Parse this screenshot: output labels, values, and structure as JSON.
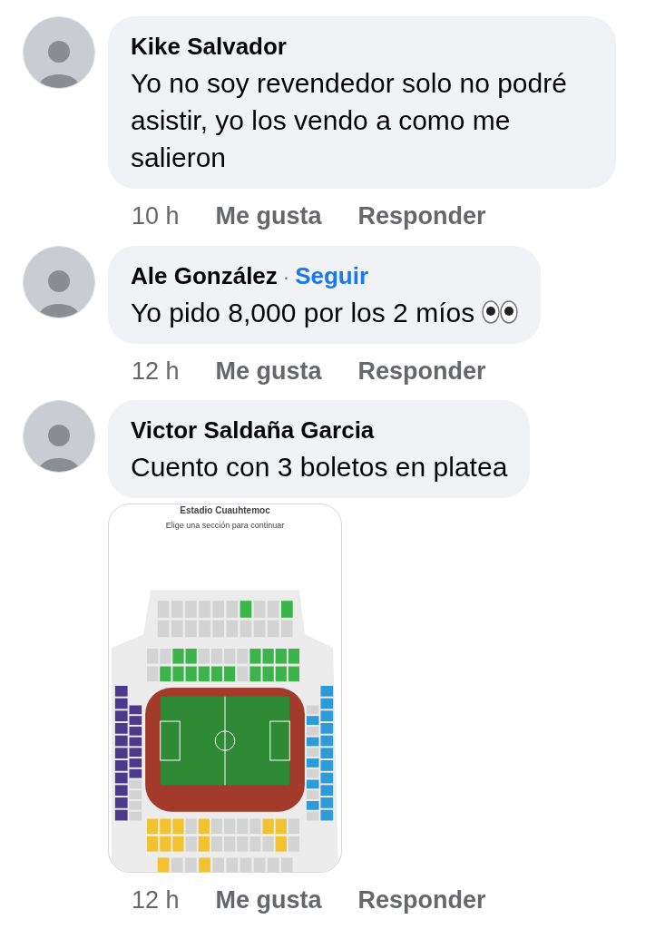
{
  "comments": [
    {
      "author": "Kike Salvador",
      "text": "Yo no soy revendedor solo no podré asistir, yo los vendo a como me salieron",
      "time": "10 h",
      "actions": [
        "Me gusta",
        "Responder"
      ]
    },
    {
      "author": "Ale González",
      "separator": "·",
      "follow": "Seguir",
      "text": "Yo pido 8,000 por los 2 míos",
      "eyes_emoji": true,
      "time": "12 h",
      "actions": [
        "Me gusta",
        "Responder"
      ]
    },
    {
      "author": "Victor Saldaña Garcia",
      "text": "Cuento con 3 boletos en platea",
      "attachment": {
        "title": "Estadio Cuauhtemoc",
        "subtitle": "Elige una sección para continuar"
      },
      "time": "12 h",
      "actions": [
        "Me gusta",
        "Responder"
      ]
    }
  ]
}
